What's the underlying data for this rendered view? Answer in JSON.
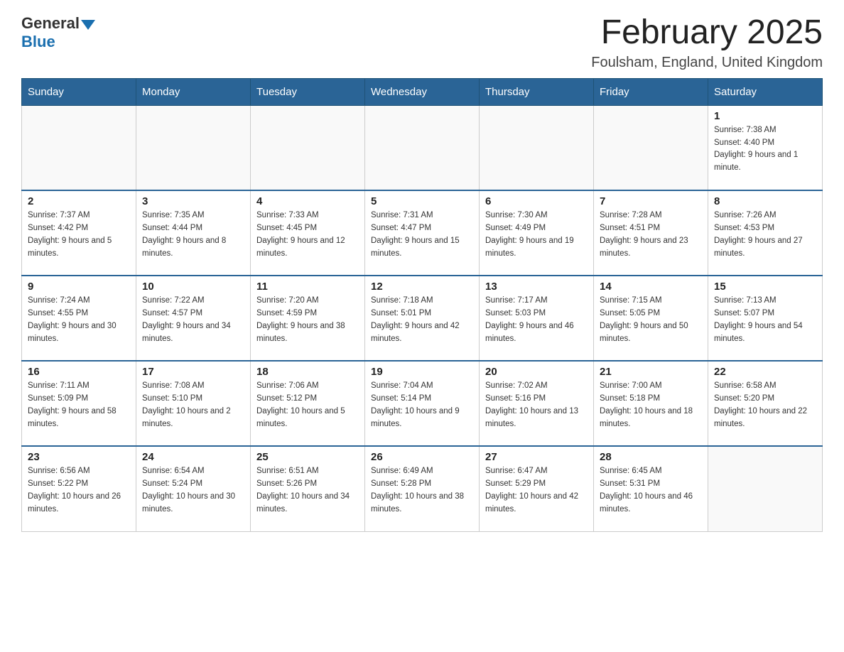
{
  "header": {
    "logo_general": "General",
    "logo_blue": "Blue",
    "month_title": "February 2025",
    "location": "Foulsham, England, United Kingdom"
  },
  "days_of_week": [
    "Sunday",
    "Monday",
    "Tuesday",
    "Wednesday",
    "Thursday",
    "Friday",
    "Saturday"
  ],
  "weeks": [
    [
      {
        "day": "",
        "info": ""
      },
      {
        "day": "",
        "info": ""
      },
      {
        "day": "",
        "info": ""
      },
      {
        "day": "",
        "info": ""
      },
      {
        "day": "",
        "info": ""
      },
      {
        "day": "",
        "info": ""
      },
      {
        "day": "1",
        "info": "Sunrise: 7:38 AM\nSunset: 4:40 PM\nDaylight: 9 hours and 1 minute."
      }
    ],
    [
      {
        "day": "2",
        "info": "Sunrise: 7:37 AM\nSunset: 4:42 PM\nDaylight: 9 hours and 5 minutes."
      },
      {
        "day": "3",
        "info": "Sunrise: 7:35 AM\nSunset: 4:44 PM\nDaylight: 9 hours and 8 minutes."
      },
      {
        "day": "4",
        "info": "Sunrise: 7:33 AM\nSunset: 4:45 PM\nDaylight: 9 hours and 12 minutes."
      },
      {
        "day": "5",
        "info": "Sunrise: 7:31 AM\nSunset: 4:47 PM\nDaylight: 9 hours and 15 minutes."
      },
      {
        "day": "6",
        "info": "Sunrise: 7:30 AM\nSunset: 4:49 PM\nDaylight: 9 hours and 19 minutes."
      },
      {
        "day": "7",
        "info": "Sunrise: 7:28 AM\nSunset: 4:51 PM\nDaylight: 9 hours and 23 minutes."
      },
      {
        "day": "8",
        "info": "Sunrise: 7:26 AM\nSunset: 4:53 PM\nDaylight: 9 hours and 27 minutes."
      }
    ],
    [
      {
        "day": "9",
        "info": "Sunrise: 7:24 AM\nSunset: 4:55 PM\nDaylight: 9 hours and 30 minutes."
      },
      {
        "day": "10",
        "info": "Sunrise: 7:22 AM\nSunset: 4:57 PM\nDaylight: 9 hours and 34 minutes."
      },
      {
        "day": "11",
        "info": "Sunrise: 7:20 AM\nSunset: 4:59 PM\nDaylight: 9 hours and 38 minutes."
      },
      {
        "day": "12",
        "info": "Sunrise: 7:18 AM\nSunset: 5:01 PM\nDaylight: 9 hours and 42 minutes."
      },
      {
        "day": "13",
        "info": "Sunrise: 7:17 AM\nSunset: 5:03 PM\nDaylight: 9 hours and 46 minutes."
      },
      {
        "day": "14",
        "info": "Sunrise: 7:15 AM\nSunset: 5:05 PM\nDaylight: 9 hours and 50 minutes."
      },
      {
        "day": "15",
        "info": "Sunrise: 7:13 AM\nSunset: 5:07 PM\nDaylight: 9 hours and 54 minutes."
      }
    ],
    [
      {
        "day": "16",
        "info": "Sunrise: 7:11 AM\nSunset: 5:09 PM\nDaylight: 9 hours and 58 minutes."
      },
      {
        "day": "17",
        "info": "Sunrise: 7:08 AM\nSunset: 5:10 PM\nDaylight: 10 hours and 2 minutes."
      },
      {
        "day": "18",
        "info": "Sunrise: 7:06 AM\nSunset: 5:12 PM\nDaylight: 10 hours and 5 minutes."
      },
      {
        "day": "19",
        "info": "Sunrise: 7:04 AM\nSunset: 5:14 PM\nDaylight: 10 hours and 9 minutes."
      },
      {
        "day": "20",
        "info": "Sunrise: 7:02 AM\nSunset: 5:16 PM\nDaylight: 10 hours and 13 minutes."
      },
      {
        "day": "21",
        "info": "Sunrise: 7:00 AM\nSunset: 5:18 PM\nDaylight: 10 hours and 18 minutes."
      },
      {
        "day": "22",
        "info": "Sunrise: 6:58 AM\nSunset: 5:20 PM\nDaylight: 10 hours and 22 minutes."
      }
    ],
    [
      {
        "day": "23",
        "info": "Sunrise: 6:56 AM\nSunset: 5:22 PM\nDaylight: 10 hours and 26 minutes."
      },
      {
        "day": "24",
        "info": "Sunrise: 6:54 AM\nSunset: 5:24 PM\nDaylight: 10 hours and 30 minutes."
      },
      {
        "day": "25",
        "info": "Sunrise: 6:51 AM\nSunset: 5:26 PM\nDaylight: 10 hours and 34 minutes."
      },
      {
        "day": "26",
        "info": "Sunrise: 6:49 AM\nSunset: 5:28 PM\nDaylight: 10 hours and 38 minutes."
      },
      {
        "day": "27",
        "info": "Sunrise: 6:47 AM\nSunset: 5:29 PM\nDaylight: 10 hours and 42 minutes."
      },
      {
        "day": "28",
        "info": "Sunrise: 6:45 AM\nSunset: 5:31 PM\nDaylight: 10 hours and 46 minutes."
      },
      {
        "day": "",
        "info": ""
      }
    ]
  ]
}
